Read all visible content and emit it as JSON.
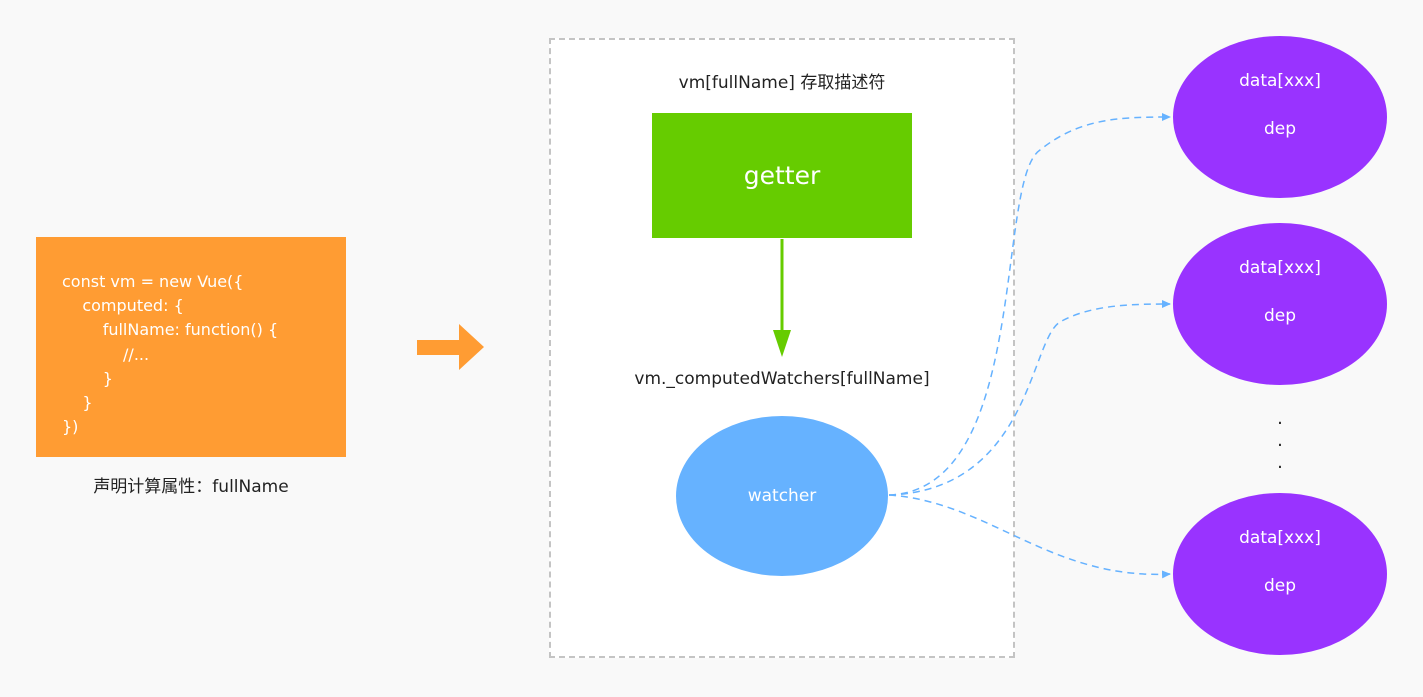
{
  "code_block": {
    "lines": [
      "const vm = new Vue({",
      "    computed: {",
      "        fullName: function() {",
      "            //...",
      "        }",
      "    }",
      "})"
    ],
    "caption": "声明计算属性：fullName"
  },
  "descriptor": {
    "title": "vm[fullName] 存取描述符",
    "getter_label": "getter",
    "watchers_label": "vm._computedWatchers[fullName]",
    "watcher_label": "watcher"
  },
  "deps": [
    {
      "line1": "data[xxx]",
      "line2": "dep"
    },
    {
      "line1": "data[xxx]",
      "line2": "dep"
    },
    {
      "line1": "data[xxx]",
      "line2": "dep"
    }
  ],
  "ellipsis": [
    ".",
    ".",
    "."
  ],
  "colors": {
    "code_box": "#ff9c33",
    "getter": "#66cc00",
    "watcher": "#66b2ff",
    "dep": "#9933ff",
    "arrow_orange": "#ff9c33",
    "arrow_green": "#66cc00",
    "arrow_blue": "#66b2ff"
  }
}
